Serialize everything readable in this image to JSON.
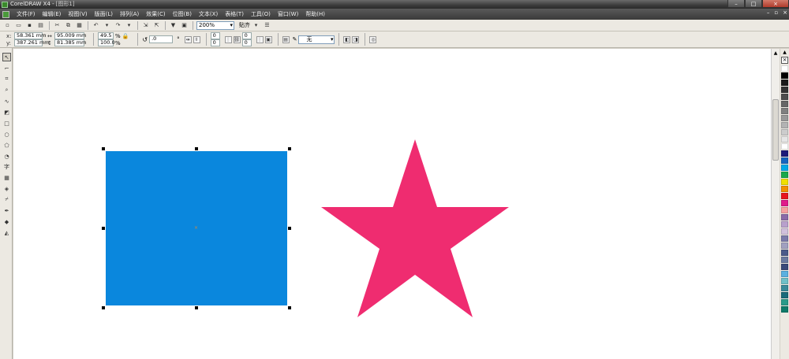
{
  "window": {
    "title": "CorelDRAW X4 - ",
    "document": "[图形1]",
    "minimize": "–",
    "maximize": "□",
    "close": "×"
  },
  "menu": {
    "items": [
      "文件(F)",
      "编辑(E)",
      "视图(V)",
      "版面(L)",
      "排列(A)",
      "效果(C)",
      "位图(B)",
      "文本(X)",
      "表格(T)",
      "工具(O)",
      "窗口(W)",
      "帮助(H)"
    ],
    "mdi_minimize": "–",
    "mdi_restore": "▫",
    "mdi_close": "×"
  },
  "toolbar": {
    "zoom": "200%",
    "snap_label": "贴齐"
  },
  "property_bar": {
    "x_label": "x:",
    "x_value": "58.361 mm",
    "y_label": "y:",
    "y_value": "387.261 mm",
    "width_value": "95.009 mm",
    "height_value": "81.385 mm",
    "scale_x": "49.5",
    "scale_y": "100.0",
    "percent": "%",
    "rotation": ".0",
    "corner_tl": "0",
    "corner_bl": "0",
    "corner_tr": "0",
    "corner_br": "0",
    "outline_width": "无"
  },
  "colors": {
    "rectangle_fill": "#0a87dd",
    "star_fill": "#ef2c70",
    "swatches": [
      "#ffffff",
      "#000000",
      "#1a1a1a",
      "#333333",
      "#4d4d4d",
      "#666666",
      "#808080",
      "#999999",
      "#b3b3b3",
      "#cccccc",
      "#e6e6e6",
      "#ffffff",
      "#1e1a7a",
      "#1565c0",
      "#00a8e8",
      "#19a84a",
      "#f0e000",
      "#f29000",
      "#e8141e",
      "#e01a8a",
      "#f5a0a0",
      "#8a6aa8",
      "#b8a0cc",
      "#d0c0dc",
      "#7a7aaa",
      "#a0a0c0",
      "#4a5a8a",
      "#6a7aa0",
      "#3a4a7a",
      "#5ab0e0",
      "#70c0c8",
      "#3a8a9a",
      "#1a6a7a",
      "#2a9a8a",
      "#0e7a6a"
    ]
  }
}
